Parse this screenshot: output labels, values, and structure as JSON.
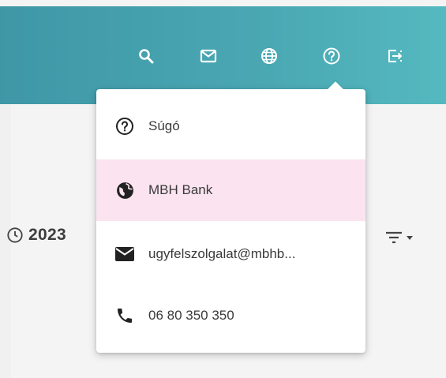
{
  "header": {
    "icons": [
      {
        "icon": "search-icon"
      },
      {
        "icon": "mail-icon"
      },
      {
        "icon": "globe-icon"
      },
      {
        "icon": "help-icon"
      },
      {
        "icon": "logout-icon"
      }
    ]
  },
  "date": {
    "text": "2023"
  },
  "menu": {
    "items": [
      {
        "icon": "help-icon",
        "label": "Súgó"
      },
      {
        "icon": "globe-icon",
        "label": "MBH Bank",
        "highlighted": true
      },
      {
        "icon": "mail-icon",
        "label": "ugyfelszolgalat@mbhb..."
      },
      {
        "icon": "phone-icon",
        "label": "06 80 350 350"
      }
    ]
  },
  "colors": {
    "header": "#4aa8b3",
    "highlight": "#fbe4ef",
    "text": "#3a3a3a"
  }
}
